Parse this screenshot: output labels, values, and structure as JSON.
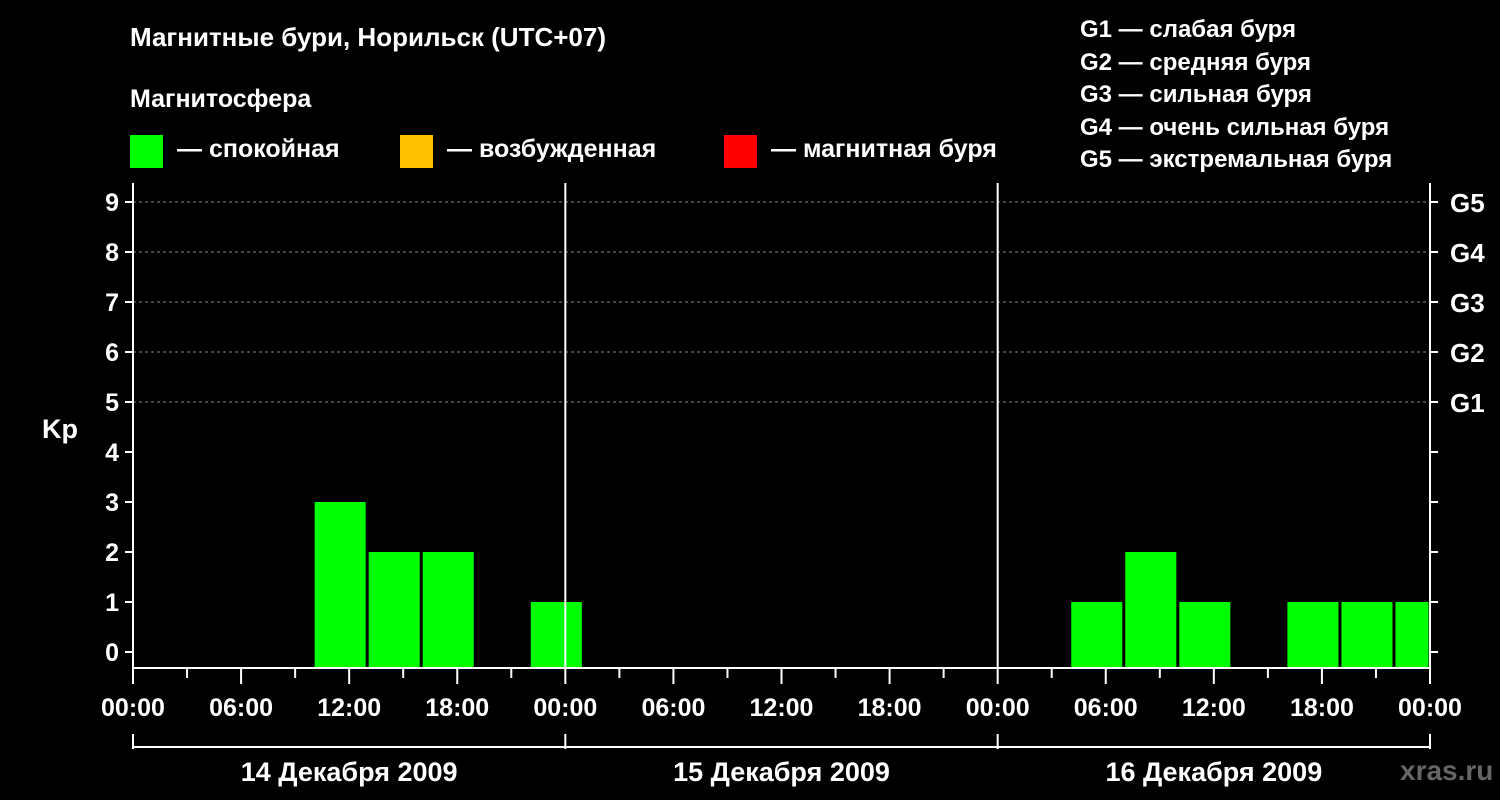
{
  "header": {
    "title": "Магнитные бури, Норильск (UTC+07)",
    "subtitle": "Магнитосфера"
  },
  "legend": [
    {
      "label": "— спокойная",
      "color": "#00ff00"
    },
    {
      "label": "— возбужденная",
      "color": "#ffc000"
    },
    {
      "label": "— магнитная буря",
      "color": "#ff0000"
    }
  ],
  "gscale": [
    "G1 — слабая буря",
    "G2 — средняя буря",
    "G3 — сильная буря",
    "G4 — очень сильная буря",
    "G5 — экстремальная буря"
  ],
  "watermark": "xras.ru",
  "colors": {
    "background": "#000000",
    "bar": "#00ff00",
    "axis": "#ffffff",
    "grid": "#888888"
  },
  "chart_data": {
    "type": "bar",
    "ylabel": "Kp",
    "ylim": [
      0,
      9
    ],
    "yticks": [
      "0",
      "1",
      "2",
      "3",
      "4",
      "5",
      "6",
      "7",
      "8",
      "9"
    ],
    "right_ticks": [
      {
        "kp": 5,
        "label": "G1"
      },
      {
        "kp": 6,
        "label": "G2"
      },
      {
        "kp": 7,
        "label": "G3"
      },
      {
        "kp": 8,
        "label": "G4"
      },
      {
        "kp": 9,
        "label": "G5"
      }
    ],
    "grid": true,
    "xtick_labels": [
      "00:00",
      "06:00",
      "12:00",
      "18:00",
      "00:00",
      "06:00",
      "12:00",
      "18:00",
      "00:00",
      "06:00",
      "12:00",
      "18:00",
      "00:00"
    ],
    "days": [
      "14 Декабря 2009",
      "15 Декабря 2009",
      "16 Декабря 2009"
    ],
    "bars": [
      {
        "day": "14 Декабря 2009",
        "start": "10:00",
        "end": "13:00",
        "kp": 3
      },
      {
        "day": "14 Декабря 2009",
        "start": "13:00",
        "end": "16:00",
        "kp": 2
      },
      {
        "day": "14 Декабря 2009",
        "start": "16:00",
        "end": "19:00",
        "kp": 2
      },
      {
        "day": "14 Декабря 2009",
        "start": "22:00",
        "end": "01:00",
        "kp": 1
      },
      {
        "day": "16 Декабря 2009",
        "start": "04:00",
        "end": "07:00",
        "kp": 1
      },
      {
        "day": "16 Декабря 2009",
        "start": "07:00",
        "end": "10:00",
        "kp": 2
      },
      {
        "day": "16 Декабря 2009",
        "start": "10:00",
        "end": "13:00",
        "kp": 1
      },
      {
        "day": "16 Декабря 2009",
        "start": "16:00",
        "end": "19:00",
        "kp": 1
      },
      {
        "day": "16 Декабря 2009",
        "start": "19:00",
        "end": "22:00",
        "kp": 1
      },
      {
        "day": "16 Декабря 2009",
        "start": "22:00",
        "end": "00:00",
        "kp": 1
      }
    ]
  }
}
